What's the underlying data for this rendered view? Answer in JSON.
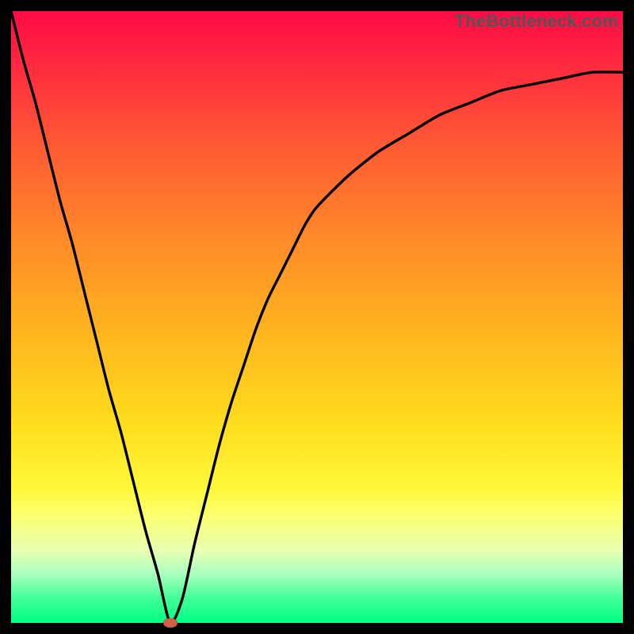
{
  "watermark": "TheBottleneck.com",
  "chart_data": {
    "type": "line",
    "title": "",
    "xlabel": "",
    "ylabel": "",
    "xlim": [
      0,
      100
    ],
    "ylim": [
      0,
      100
    ],
    "grid": false,
    "x": [
      0,
      2,
      4,
      6,
      8,
      10,
      12,
      14,
      16,
      18,
      20,
      22,
      24,
      26,
      28,
      30,
      32,
      34,
      36,
      38,
      40,
      42,
      44,
      46,
      48,
      50,
      55,
      60,
      65,
      70,
      75,
      80,
      85,
      90,
      95,
      100
    ],
    "values": [
      100,
      92,
      85,
      77,
      69,
      62,
      54,
      46,
      38,
      31,
      23,
      15,
      8,
      0,
      4,
      13,
      21,
      29,
      36,
      42,
      48,
      53,
      57,
      61,
      65,
      68,
      73,
      77,
      80,
      83,
      85,
      87,
      88,
      89,
      90,
      90
    ],
    "marker": {
      "x": 26,
      "y": 0
    },
    "background_gradient": {
      "direction": "vertical",
      "stops": [
        {
          "pos": 0.0,
          "color": "#ff0a46"
        },
        {
          "pos": 0.1,
          "color": "#ff2e3e"
        },
        {
          "pos": 0.22,
          "color": "#ff5a34"
        },
        {
          "pos": 0.38,
          "color": "#ff8c28"
        },
        {
          "pos": 0.54,
          "color": "#ffb91e"
        },
        {
          "pos": 0.68,
          "color": "#ffde1e"
        },
        {
          "pos": 0.78,
          "color": "#fff83a"
        },
        {
          "pos": 0.82,
          "color": "#fdff6a"
        },
        {
          "pos": 0.88,
          "color": "#eaffb0"
        },
        {
          "pos": 0.92,
          "color": "#aaffc0"
        },
        {
          "pos": 0.96,
          "color": "#41ff96"
        },
        {
          "pos": 1.0,
          "color": "#00ff84"
        }
      ]
    }
  }
}
